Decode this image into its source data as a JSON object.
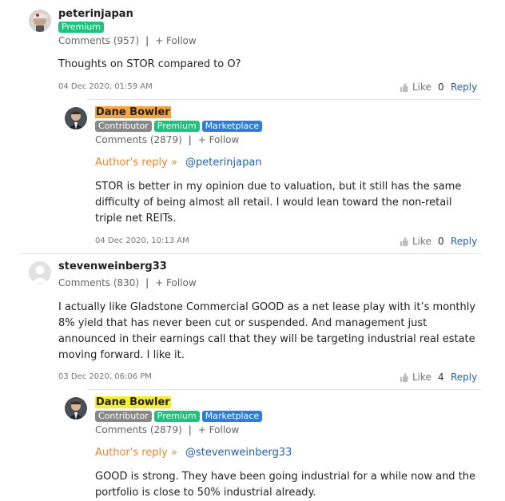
{
  "comments": [
    {
      "username": "peterinjapan",
      "badges": [
        "Premium"
      ],
      "comments_count": "Comments (957)",
      "follow": "+ Follow",
      "text": "Thoughts on STOR compared to O?",
      "date": "04 Dec 2020, 01:59 AM",
      "like_label": "Like",
      "like_count": "0",
      "reply_label": "Reply"
    },
    {
      "username": "Dane Bowler",
      "badges": [
        "Contributor",
        "Premium",
        "Marketplace"
      ],
      "comments_count": "Comments (2879)",
      "follow": "+ Follow",
      "author_reply": "Author's reply »",
      "mention": "@peterinjapan",
      "text": "STOR is better in my opinion due to valuation, but it still has the same difficulty of being almost all retail. I would lean toward the non-retail triple net REITs.",
      "date": "04 Dec 2020, 10:13 AM",
      "like_label": "Like",
      "like_count": "0",
      "reply_label": "Reply"
    },
    {
      "username": "stevenweinberg33",
      "comments_count": "Comments (830)",
      "follow": "+ Follow",
      "text": "I actually like Gladstone Commercial GOOD as a net lease play with it’s monthly 8% yield that has never been cut or suspended. And management just announced in their earnings call that they will be targeting industrial real estate moving forward. I like it.",
      "date": "03 Dec 2020, 06:06 PM",
      "like_label": "Like",
      "like_count": "4",
      "reply_label": "Reply"
    },
    {
      "username": "Dane Bowler",
      "badges": [
        "Contributor",
        "Premium",
        "Marketplace"
      ],
      "comments_count": "Comments (2879)",
      "follow": "+ Follow",
      "author_reply": "Author's reply »",
      "mention": "@stevenweinberg33",
      "text": "GOOD is strong. They have been going industrial for a while now and the portfolio is close to 50% industrial already."
    }
  ]
}
